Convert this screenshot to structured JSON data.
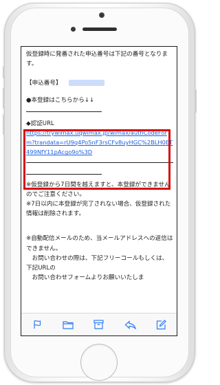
{
  "email": {
    "line1": "仮登録時に発番された申込番号は下記の番号となります。",
    "application_number_label": "【申込番号】",
    "register_prompt": "●本登録はこちらから↓↓",
    "auth_url_label": "◆認証URL",
    "auth_url": "https://trywimax.uqwimax.jp/wimax/authCodeForm?trandata=rU9q4Po5nF3rsCFv8uyHGC%2BLH0ET499NfY11pAcgo9o%3D",
    "notice1": "※仮登録から7日間を越えますと、本登録ができませんのでご注意ください。",
    "notice2": "※7日以内に本登録が完了されない場合、仮登録された情報は削除されます。",
    "auto_mail_notice": "※自動配信メールのため、当メールアドレスへの返信はできません。",
    "inquiry_line": "お問い合わせの際は、下記フリーコールもしくは、下記URLの",
    "inquiry_form_line": "お問い合わせフォームよりお願いいたしま"
  },
  "toolbar": {
    "icons": [
      "flag-icon",
      "folder-icon",
      "archive-icon",
      "reply-icon",
      "compose-icon"
    ]
  },
  "colors": {
    "link": "#1a5fe0",
    "highlight_border": "#d60a0a",
    "toolbar_icon": "#2f7cf6"
  }
}
